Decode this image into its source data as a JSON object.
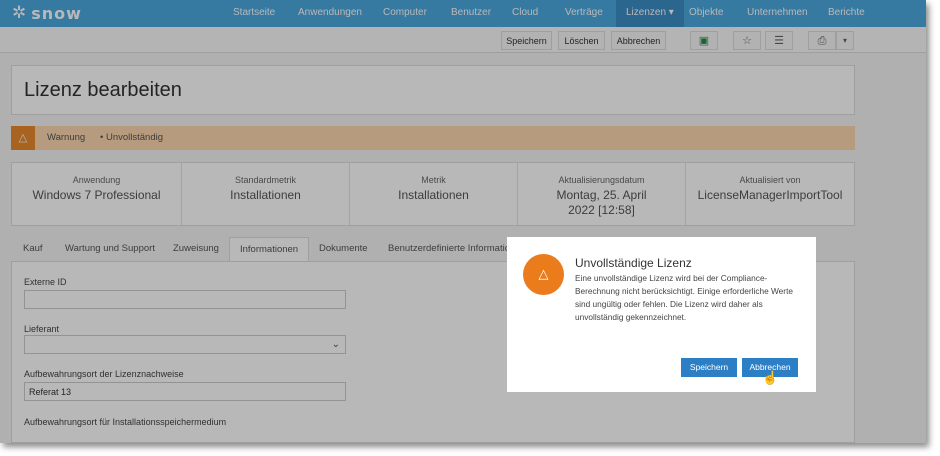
{
  "nav": {
    "logo": "snow",
    "items": [
      "Startseite",
      "Anwendungen",
      "Computer",
      "Benutzer",
      "Cloud",
      "Verträge",
      "Lizenzen ▾",
      "Objekte",
      "Unternehmen",
      "Berichte"
    ]
  },
  "toolbar": {
    "save": "Speichern",
    "delete": "Löschen",
    "cancel": "Abbrechen"
  },
  "page": {
    "title": "Lizenz bearbeiten"
  },
  "warning": {
    "label": "Warnung",
    "item": "• Unvollständig"
  },
  "info": [
    {
      "label": "Anwendung",
      "value": "Windows 7 Professional"
    },
    {
      "label": "Standardmetrik",
      "value": "Installationen"
    },
    {
      "label": "Metrik",
      "value": "Installationen"
    },
    {
      "label": "Aktualisierungsdatum",
      "value": "Montag, 25. April 2022   [12:58]"
    },
    {
      "label": "Aktualisiert von",
      "value": "LicenseManagerImportTool"
    }
  ],
  "tabs": [
    "Kauf",
    "Wartung und Support",
    "Zuweisung",
    "Informationen",
    "Dokumente",
    "Benutzerdefinierte Information"
  ],
  "form": {
    "external_id_label": "Externe ID",
    "external_id_value": "",
    "supplier_label": "Lieferant",
    "supplier_value": "",
    "proof_location_label": "Aufbewahrungsort der Lizenznachweise",
    "proof_location_value": "Referat 13",
    "media_location_label": "Aufbewahrungsort für Installationsspeichermedium"
  },
  "modal": {
    "title": "Unvollständige Lizenz",
    "body": "Eine unvollständige Lizenz wird bei der Compliance-Berechnung nicht berücksichtigt. Einige erforderliche Werte sind ungültig oder fehlen. Die Lizenz wird daher als unvollständig gekennzeichnet.",
    "save": "Speichern",
    "cancel": "Abbrechen"
  },
  "colors": {
    "nav_bg": "#4ca8e0",
    "accent": "#2d7fc5",
    "warning": "#ea7c1c"
  },
  "icons": [
    "gear-logo-icon",
    "compliance-icon",
    "star-icon",
    "list-icon",
    "print-icon",
    "chevron-down-icon",
    "warning-icon",
    "hand-cursor-icon"
  ]
}
